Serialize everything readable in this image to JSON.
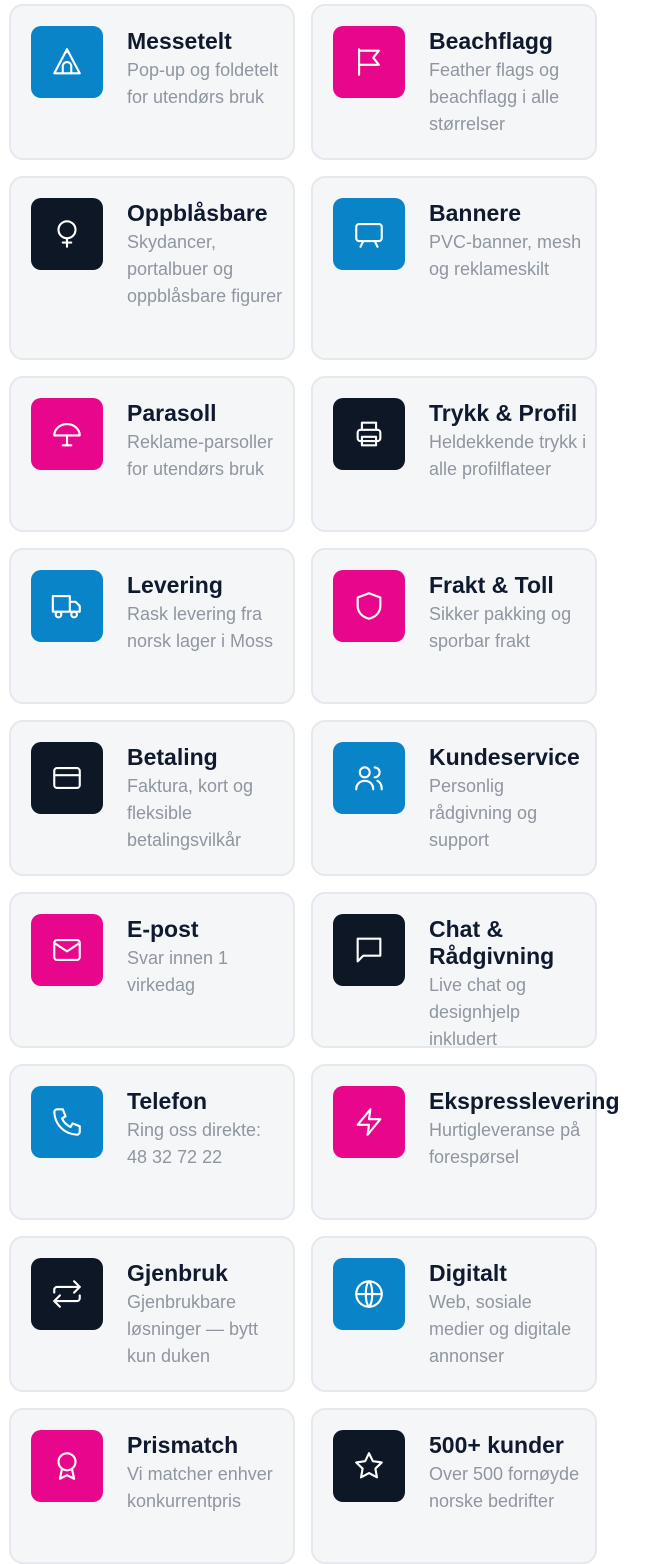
{
  "cards": [
    {
      "title": "Messetelt",
      "desc": "Pop-up og foldetelt for utendørs bruk",
      "icon": "tent-icon",
      "color": "#0a84c9"
    },
    {
      "title": "Beachflagg",
      "desc": "Feather flags og beachflagg i alle størrelser",
      "icon": "flag-icon",
      "color": "#e8078c"
    },
    {
      "title": "Oppblåsbare",
      "desc": "Skydancer, portalbuer og oppblåsbare figurer",
      "icon": "balloon-icon",
      "color": "#0d1726"
    },
    {
      "title": "Bannere",
      "desc": "PVC-banner, mesh og reklameskilt",
      "icon": "easel-icon",
      "color": "#0a84c9"
    },
    {
      "title": "Parasoll",
      "desc": "Reklame-parsoller for utendørs bruk",
      "icon": "umbrella-icon",
      "color": "#e8078c"
    },
    {
      "title": "Trykk & Profil",
      "desc": "Heldekkende trykk i alle profilflateer",
      "icon": "printer-icon",
      "color": "#0d1726"
    },
    {
      "title": "Levering",
      "desc": "Rask levering fra norsk lager i Moss",
      "icon": "truck-icon",
      "color": "#0a84c9"
    },
    {
      "title": "Frakt & Toll",
      "desc": "Sikker pakking og sporbar frakt",
      "icon": "shield-icon",
      "color": "#e8078c"
    },
    {
      "title": "Betaling",
      "desc": "Faktura, kort og fleksible betalingsvilkår",
      "icon": "credit-card-icon",
      "color": "#0d1726"
    },
    {
      "title": "Kundeservice",
      "desc": "Personlig rådgivning og support",
      "icon": "users-icon",
      "color": "#0a84c9"
    },
    {
      "title": "E-post",
      "desc": "Svar innen 1 virkedag",
      "icon": "mail-icon",
      "color": "#e8078c"
    },
    {
      "title": "Chat & Rådgivning",
      "desc": "Live chat og designhjelp inkludert",
      "icon": "chat-icon",
      "color": "#0d1726"
    },
    {
      "title": "Telefon",
      "desc": "Ring oss direkte: 48 32 72 22",
      "icon": "phone-icon",
      "color": "#0a84c9"
    },
    {
      "title": "Ekspresslevering",
      "desc": "Hurtigleveranse på forespørsel",
      "icon": "lightning-icon",
      "color": "#e8078c"
    },
    {
      "title": "Gjenbruk",
      "desc": "Gjenbrukbare løsninger — bytt kun duken",
      "icon": "repeat-icon",
      "color": "#0d1726"
    },
    {
      "title": "Digitalt",
      "desc": "Web, sosiale medier og digitale annonser",
      "icon": "globe-icon",
      "color": "#0a84c9"
    },
    {
      "title": "Prismatch",
      "desc": "Vi matcher enhver konkurrentpris",
      "icon": "award-icon",
      "color": "#e8078c"
    },
    {
      "title": "500+ kunder",
      "desc": "Over 500 fornøyde norske bedrifter",
      "icon": "star-icon",
      "color": "#0d1726"
    }
  ]
}
